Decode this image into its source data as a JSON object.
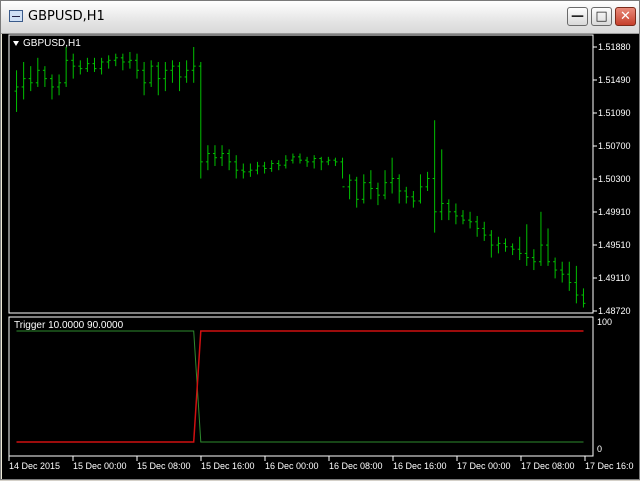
{
  "window": {
    "title": "GBPUSD,H1",
    "min_glyph": "—",
    "max_glyph": "□",
    "close_glyph": "✕",
    "icon": "chart-window-icon"
  },
  "main_pane": {
    "label": "GBPUSD,H1",
    "price_labels": [
      "1.51880",
      "1.51490",
      "1.51090",
      "1.50700",
      "1.50300",
      "1.49910",
      "1.49510",
      "1.49110",
      "1.48720"
    ],
    "bar_color": "#00c000"
  },
  "indicator_pane": {
    "label": "Trigger 10.0000 90.0000",
    "scale_labels": [
      "100",
      "0"
    ],
    "line1_color": "#2e8b2e",
    "line2_color": "#d01010"
  },
  "time_axis": {
    "labels": [
      "14 Dec 2015",
      "15 Dec 00:00",
      "15 Dec 08:00",
      "15 Dec 16:00",
      "16 Dec 00:00",
      "16 Dec 08:00",
      "16 Dec 16:00",
      "17 Dec 00:00",
      "17 Dec 08:00",
      "17 Dec 16:0"
    ]
  },
  "chart_data": {
    "type": "line",
    "symbol": "GBPUSD",
    "timeframe": "H1",
    "ylim": [
      1.4872,
      1.5188
    ],
    "x_start": "14 Dec 2015",
    "bars": [
      [
        1.5135,
        1.516,
        1.511,
        1.514
      ],
      [
        1.514,
        1.517,
        1.5125,
        1.515
      ],
      [
        1.515,
        1.5165,
        1.5135,
        1.5145
      ],
      [
        1.5145,
        1.5175,
        1.514,
        1.516
      ],
      [
        1.516,
        1.5165,
        1.514,
        1.515
      ],
      [
        1.515,
        1.5155,
        1.5125,
        1.514
      ],
      [
        1.514,
        1.5155,
        1.513,
        1.5145
      ],
      [
        1.5145,
        1.5188,
        1.514,
        1.5172
      ],
      [
        1.5172,
        1.518,
        1.515,
        1.5165
      ],
      [
        1.5165,
        1.5172,
        1.5155,
        1.5162
      ],
      [
        1.5162,
        1.5175,
        1.5158,
        1.5168
      ],
      [
        1.5168,
        1.5175,
        1.5158,
        1.5162
      ],
      [
        1.5162,
        1.5175,
        1.5155,
        1.517
      ],
      [
        1.517,
        1.5178,
        1.5162,
        1.5172
      ],
      [
        1.5172,
        1.518,
        1.5165,
        1.5175
      ],
      [
        1.5175,
        1.518,
        1.516,
        1.517
      ],
      [
        1.517,
        1.5182,
        1.5162,
        1.5172
      ],
      [
        1.5172,
        1.518,
        1.515,
        1.516
      ],
      [
        1.516,
        1.517,
        1.513,
        1.5145
      ],
      [
        1.5145,
        1.5172,
        1.514,
        1.5165
      ],
      [
        1.5165,
        1.517,
        1.513,
        1.515
      ],
      [
        1.515,
        1.517,
        1.5135,
        1.516
      ],
      [
        1.516,
        1.5172,
        1.5145,
        1.5165
      ],
      [
        1.5165,
        1.517,
        1.5135,
        1.5152
      ],
      [
        1.5152,
        1.5172,
        1.5145,
        1.516
      ],
      [
        1.516,
        1.5188,
        1.5145,
        1.5165
      ],
      [
        1.5165,
        1.517,
        1.503,
        1.505
      ],
      [
        1.505,
        1.507,
        1.504,
        1.506
      ],
      [
        1.506,
        1.507,
        1.5045,
        1.5055
      ],
      [
        1.5055,
        1.507,
        1.5045,
        1.506
      ],
      [
        1.506,
        1.5065,
        1.504,
        1.505
      ],
      [
        1.505,
        1.5058,
        1.503,
        1.504
      ],
      [
        1.504,
        1.5048,
        1.503,
        1.5038
      ],
      [
        1.5038,
        1.5048,
        1.5032,
        1.504
      ],
      [
        1.504,
        1.505,
        1.5035,
        1.5045
      ],
      [
        1.5045,
        1.505,
        1.5036,
        1.5042
      ],
      [
        1.5042,
        1.5052,
        1.5038,
        1.5048
      ],
      [
        1.5048,
        1.5052,
        1.504,
        1.5046
      ],
      [
        1.5046,
        1.5058,
        1.5042,
        1.5052
      ],
      [
        1.5052,
        1.506,
        1.5048,
        1.5056
      ],
      [
        1.5056,
        1.506,
        1.5048,
        1.5052
      ],
      [
        1.5052,
        1.5056,
        1.5044,
        1.505
      ],
      [
        1.505,
        1.5058,
        1.5042,
        1.5054
      ],
      [
        1.5054,
        1.5056,
        1.504,
        1.505
      ],
      [
        1.505,
        1.5056,
        1.5046,
        1.5052
      ],
      [
        1.5052,
        1.5055,
        1.5045,
        1.505
      ],
      [
        1.505,
        1.5055,
        1.503,
        1.502
      ],
      [
        1.502,
        1.5035,
        1.5005,
        1.5028
      ],
      [
        1.5028,
        1.5032,
        1.4995,
        1.5005
      ],
      [
        1.5005,
        1.5035,
        1.5,
        1.5025
      ],
      [
        1.5025,
        1.504,
        1.5005,
        1.5018
      ],
      [
        1.5018,
        1.5025,
        1.4998,
        1.501
      ],
      [
        1.501,
        1.504,
        1.5005,
        1.5025
      ],
      [
        1.5025,
        1.5055,
        1.5012,
        1.503
      ],
      [
        1.503,
        1.5035,
        1.5,
        1.5015
      ],
      [
        1.5015,
        1.502,
        1.5,
        1.5008
      ],
      [
        1.5008,
        1.5015,
        1.4995,
        1.5003
      ],
      [
        1.5003,
        1.5035,
        1.5,
        1.502
      ],
      [
        1.502,
        1.5038,
        1.5015,
        1.503
      ],
      [
        1.503,
        1.51,
        1.4965,
        1.499
      ],
      [
        1.499,
        1.5065,
        1.498,
        1.5
      ],
      [
        1.5,
        1.5005,
        1.498,
        1.499
      ],
      [
        1.499,
        1.5,
        1.4975,
        1.4985
      ],
      [
        1.4985,
        1.4992,
        1.4975,
        1.498
      ],
      [
        1.498,
        1.499,
        1.497,
        1.4978
      ],
      [
        1.4978,
        1.4985,
        1.496,
        1.497
      ],
      [
        1.497,
        1.4978,
        1.4955,
        1.4962
      ],
      [
        1.4962,
        1.4968,
        1.4935,
        1.495
      ],
      [
        1.495,
        1.496,
        1.494,
        1.4952
      ],
      [
        1.4952,
        1.4958,
        1.4942,
        1.4948
      ],
      [
        1.4948,
        1.4952,
        1.4938,
        1.4945
      ],
      [
        1.4945,
        1.496,
        1.4932,
        1.494
      ],
      [
        1.494,
        1.4975,
        1.4925,
        1.4935
      ],
      [
        1.4935,
        1.4945,
        1.492,
        1.493
      ],
      [
        1.493,
        1.499,
        1.4925,
        1.495
      ],
      [
        1.495,
        1.497,
        1.4925,
        1.493
      ],
      [
        1.493,
        1.4935,
        1.491,
        1.492
      ],
      [
        1.492,
        1.493,
        1.4905,
        1.4915
      ],
      [
        1.4915,
        1.493,
        1.4895,
        1.4905
      ],
      [
        1.4905,
        1.4925,
        1.488,
        1.489
      ],
      [
        1.489,
        1.4898,
        1.4875,
        1.488
      ]
    ],
    "indicator": {
      "name": "Trigger",
      "levels": [
        10,
        90
      ],
      "ylim": [
        0,
        100
      ],
      "green": [
        100,
        100,
        100,
        100,
        100,
        100,
        100,
        100,
        100,
        100,
        100,
        100,
        100,
        100,
        100,
        100,
        100,
        100,
        100,
        100,
        100,
        100,
        100,
        100,
        100,
        100,
        0,
        0,
        0,
        0,
        0,
        0,
        0,
        0,
        0,
        0,
        0,
        0,
        0,
        0,
        0,
        0,
        0,
        0,
        0,
        0,
        0,
        0,
        0,
        0,
        0,
        0,
        0,
        0,
        0,
        0,
        0,
        0,
        0,
        0,
        0,
        0,
        0,
        0,
        0,
        0,
        0,
        0,
        0,
        0,
        0,
        0,
        0,
        0,
        0,
        0,
        0,
        0,
        0,
        0,
        0
      ],
      "red": [
        0,
        0,
        0,
        0,
        0,
        0,
        0,
        0,
        0,
        0,
        0,
        0,
        0,
        0,
        0,
        0,
        0,
        0,
        0,
        0,
        0,
        0,
        0,
        0,
        0,
        0,
        100,
        100,
        100,
        100,
        100,
        100,
        100,
        100,
        100,
        100,
        100,
        100,
        100,
        100,
        100,
        100,
        100,
        100,
        100,
        100,
        100,
        100,
        100,
        100,
        100,
        100,
        100,
        100,
        100,
        100,
        100,
        100,
        100,
        100,
        100,
        100,
        100,
        100,
        100,
        100,
        100,
        100,
        100,
        100,
        100,
        100,
        100,
        100,
        100,
        100,
        100,
        100,
        100,
        100,
        100
      ]
    }
  }
}
